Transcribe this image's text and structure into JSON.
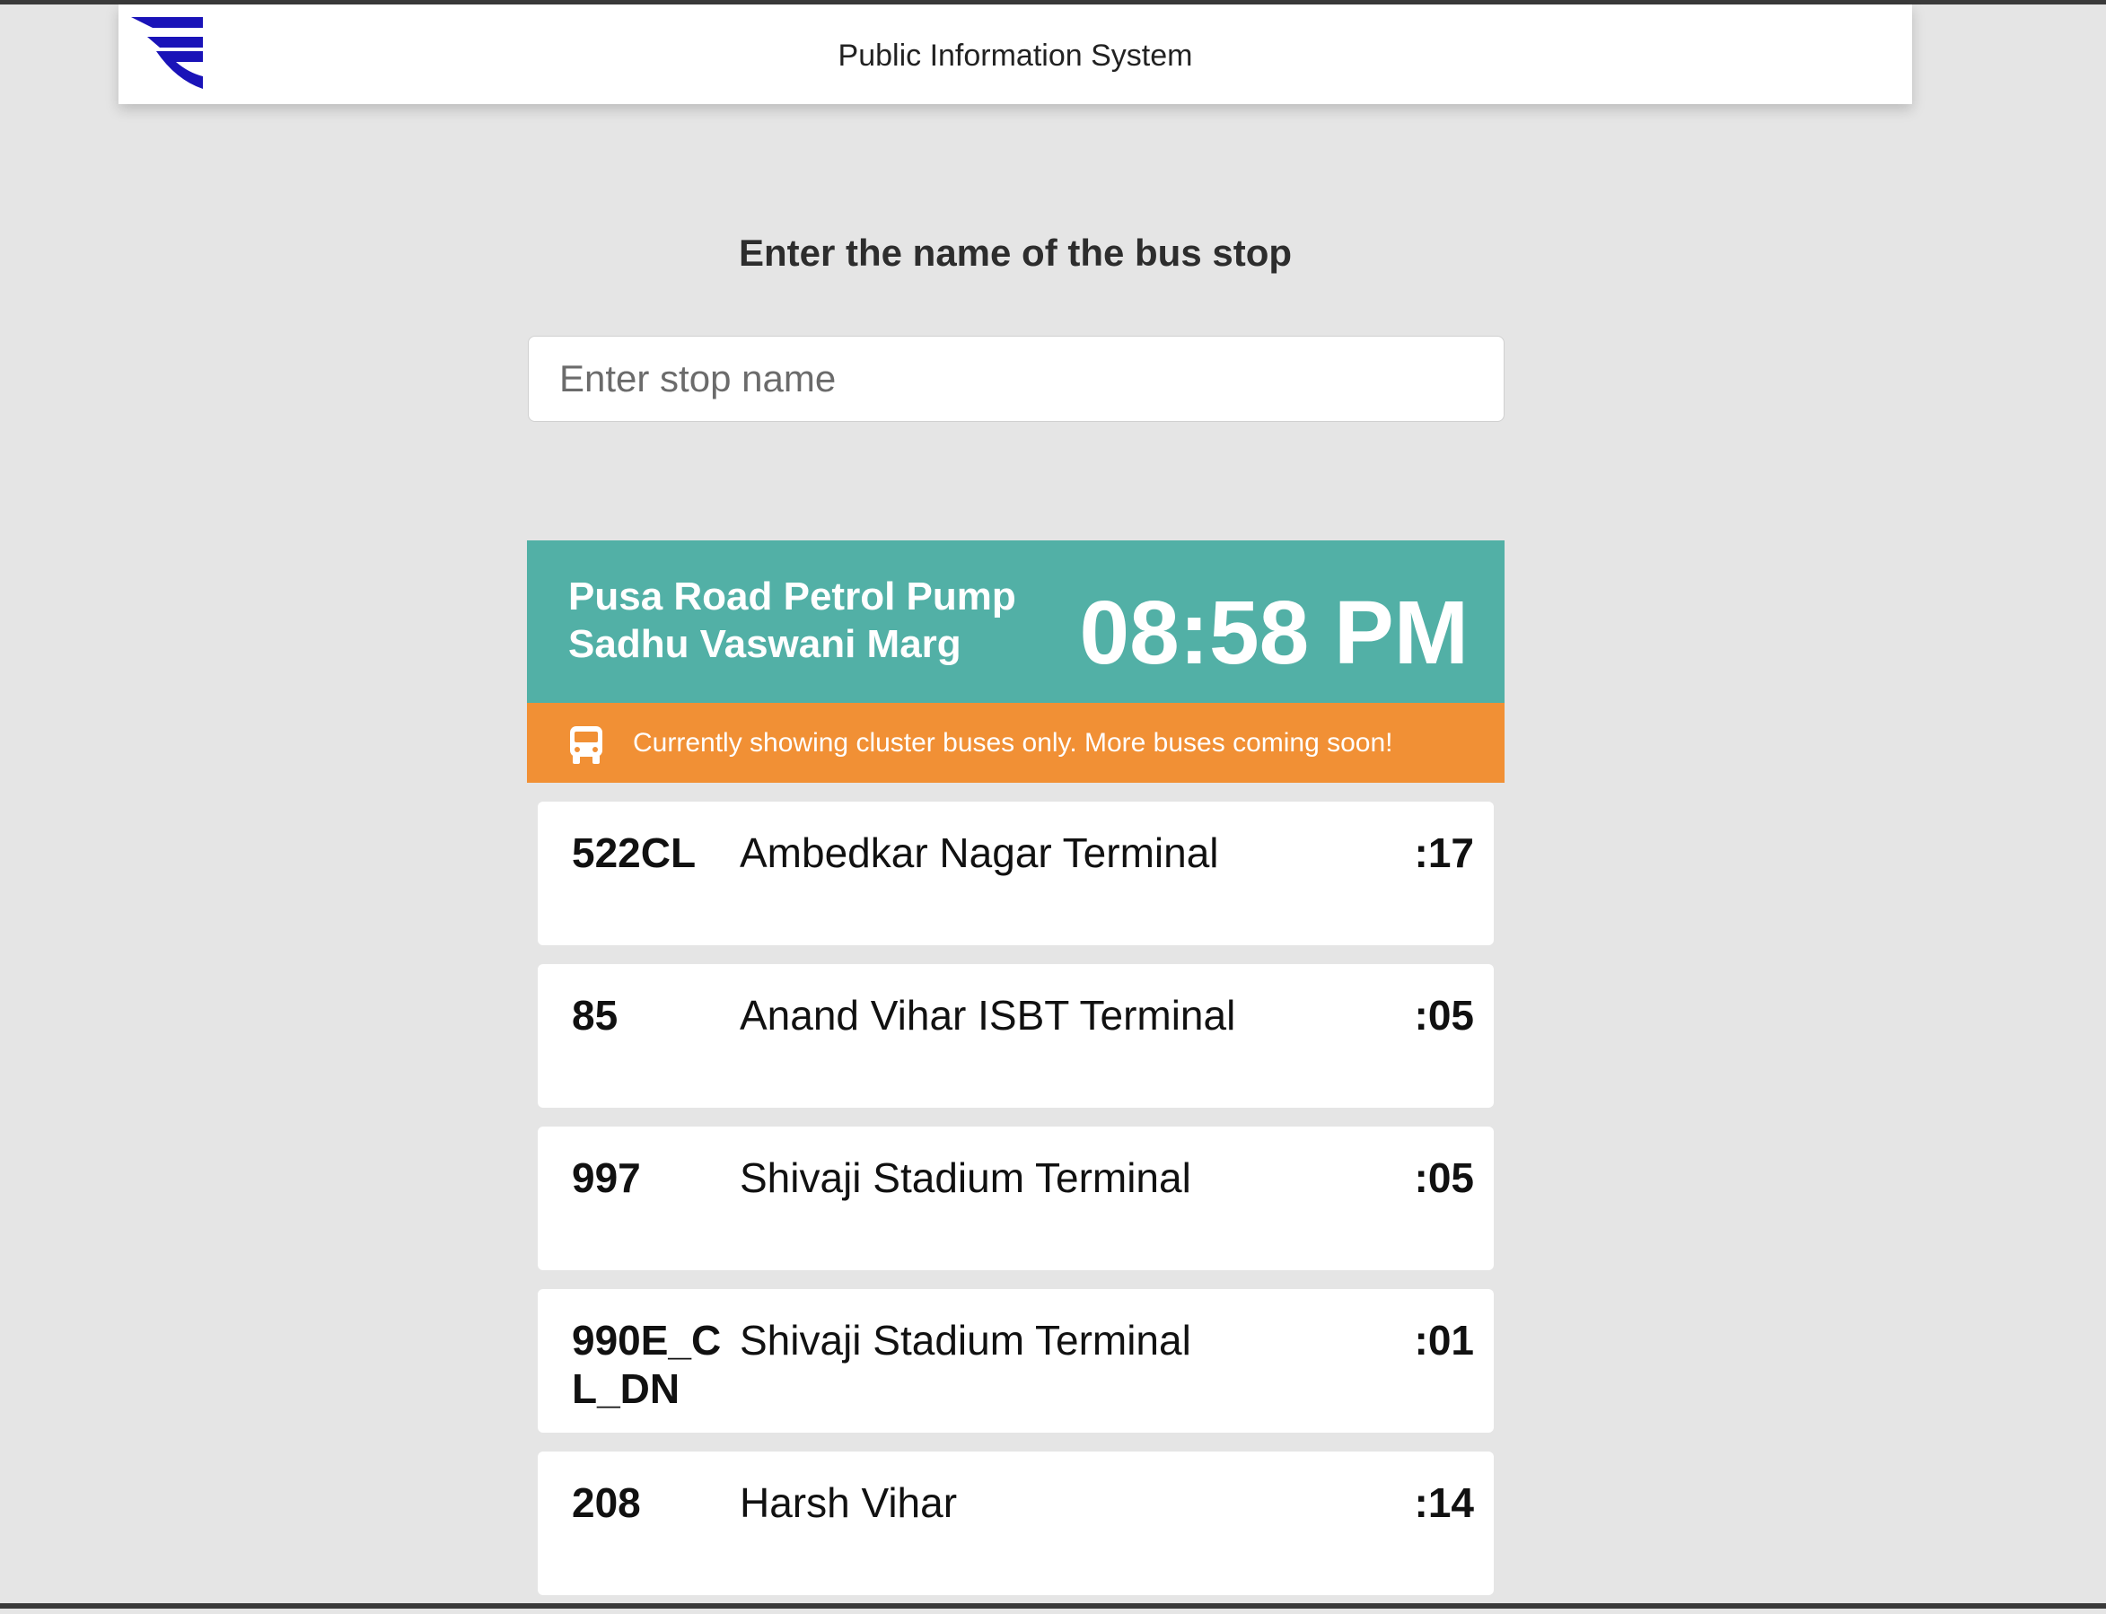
{
  "header": {
    "title": "Public Information System",
    "logo_icon": "brand-logo-icon",
    "logo_color": "#1a13b8"
  },
  "search": {
    "prompt": "Enter the name of the bus stop",
    "placeholder": "Enter stop name",
    "value": ""
  },
  "stop": {
    "name_line1": "Pusa Road Petrol Pump",
    "name_line2": "Sadhu Vaswani Marg",
    "time": "08:58 PM",
    "color": "#52b0a6"
  },
  "notice": {
    "icon": "bus-icon",
    "text": "Currently showing cluster buses only. More buses coming soon!",
    "color": "#f19035"
  },
  "arrivals": [
    {
      "route": "522CL",
      "destination": "Ambedkar Nagar Terminal",
      "eta": ":17"
    },
    {
      "route": "85",
      "destination": "Anand Vihar ISBT Terminal",
      "eta": ":05"
    },
    {
      "route": "997",
      "destination": "Shivaji Stadium Terminal",
      "eta": ":05"
    },
    {
      "route": "990E_CL_DN",
      "destination": "Shivaji Stadium Terminal",
      "eta": ":01"
    },
    {
      "route": "208",
      "destination": "Harsh Vihar",
      "eta": ":14"
    }
  ]
}
